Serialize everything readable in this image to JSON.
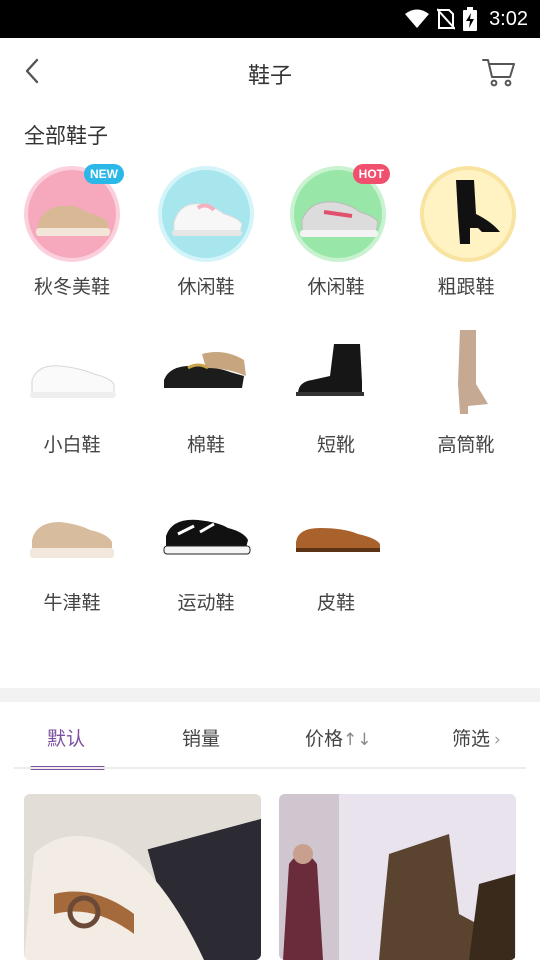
{
  "status_bar": {
    "time": "3:02",
    "icons": [
      "wifi-icon",
      "no-sim-icon",
      "battery-charging-icon"
    ]
  },
  "nav": {
    "title": "鞋子",
    "back_icon": "chevron-left-icon",
    "cart_icon": "cart-icon"
  },
  "section": {
    "title": "全部鞋子"
  },
  "categories": [
    {
      "label": "秋冬美鞋",
      "badge": "NEW",
      "icon": "sneaker-icon"
    },
    {
      "label": "休闲鞋",
      "badge": "",
      "icon": "sneaker-icon"
    },
    {
      "label": "休闲鞋",
      "badge": "HOT",
      "icon": "sneaker-icon"
    },
    {
      "label": "粗跟鞋",
      "badge": "",
      "icon": "boot-icon"
    },
    {
      "label": "小白鞋",
      "badge": "",
      "icon": "white-sneaker-icon"
    },
    {
      "label": "棉鞋",
      "badge": "",
      "icon": "loafer-icon"
    },
    {
      "label": "短靴",
      "badge": "",
      "icon": "ankle-boot-icon"
    },
    {
      "label": "高筒靴",
      "badge": "",
      "icon": "tall-boot-icon"
    },
    {
      "label": "牛津鞋",
      "badge": "",
      "icon": "oxford-icon"
    },
    {
      "label": "运动鞋",
      "badge": "",
      "icon": "sports-shoe-icon"
    },
    {
      "label": "皮鞋",
      "badge": "",
      "icon": "leather-shoe-icon"
    }
  ],
  "sort": {
    "default": "默认",
    "sales": "销量",
    "price": "价格",
    "price_icon": "↑↓",
    "filter": "筛选",
    "filter_icon": "›",
    "active": "默认"
  },
  "colors": {
    "accent": "#7d4f9e",
    "badge_new": "#2bb8e8",
    "badge_hot": "#f0506e"
  }
}
